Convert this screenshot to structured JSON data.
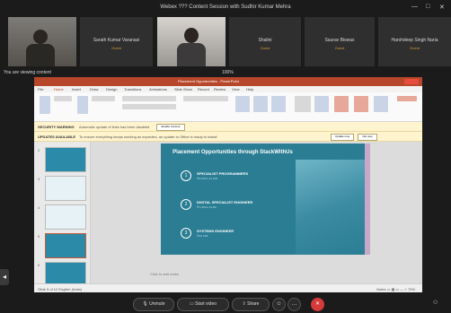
{
  "meeting": {
    "title": "Webex ??? Content Session with Sudhir Kumar Mehra",
    "window_controls": [
      "—",
      "□",
      "✕"
    ],
    "zoom": "100%",
    "share_label": "You are viewing content"
  },
  "participants": [
    {
      "kind": "video",
      "caption": ""
    },
    {
      "kind": "name",
      "name": "Sarath Kumar Varanasi",
      "sub": "Guest"
    },
    {
      "kind": "video",
      "caption": ""
    },
    {
      "kind": "name",
      "name": "Shalini",
      "sub": "Guest"
    },
    {
      "kind": "name",
      "name": "Saurav Biswas",
      "sub": "Guest"
    },
    {
      "kind": "name",
      "name": "Harshdeep Singh Naria",
      "sub": "Guest"
    }
  ],
  "powerpoint": {
    "titlebar": "Placement Opportunities - PowerPoint",
    "tabs": [
      "File",
      "Home",
      "Insert",
      "Draw",
      "Design",
      "Transitions",
      "Animations",
      "Slide Show",
      "Record",
      "Review",
      "View",
      "Help"
    ],
    "notice1": {
      "tag": "SECURITY WARNING",
      "text": "Automatic update of links has been disabled",
      "button": "Enable Content"
    },
    "notice2": {
      "tag": "UPDATES AVAILABLE",
      "text": "To ensure everything keeps working as expected, an update to Office is ready to install",
      "buttons": [
        "Update now",
        "Not now"
      ]
    },
    "slide": {
      "title": "Placement Opportunities through StackWithUs",
      "options": [
        {
          "num": "1",
          "label": "SPECIALIST PROGRAMMERS",
          "sub": "₹9 LPA to 11 LPA"
        },
        {
          "num": "2",
          "label": "DIGITAL SPECIALIST ENGINEER",
          "sub": "₹7 LPA to 9 LPA"
        },
        {
          "num": "3",
          "label": "SYSTEMS ENGINEER",
          "sub": "₹3.6 LPA"
        }
      ]
    },
    "notes": "Click to add notes",
    "status_left": "Slide 5 of 12   English (India)",
    "status_right": "Notes   ▭   ▦   ▭   —  +  79%"
  },
  "controls": {
    "unmute": "Unmute",
    "start_video": "Start video",
    "share": "Share",
    "more": "…",
    "end": "✕"
  }
}
